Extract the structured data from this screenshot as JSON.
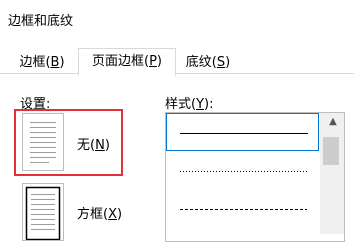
{
  "window": {
    "title": "边框和底纹"
  },
  "tabs": [
    {
      "pre": "边框(",
      "key": "B",
      "post": ")"
    },
    {
      "pre": "页面边框(",
      "key": "P",
      "post": ")"
    },
    {
      "pre": "底纹(",
      "key": "S",
      "post": ")"
    }
  ],
  "active_tab_index": 1,
  "settings": {
    "label": "设置:",
    "options": [
      {
        "pre": "无(",
        "key": "N",
        "post": ")"
      },
      {
        "pre": "方框(",
        "key": "X",
        "post": ")"
      }
    ],
    "selected_index": 0
  },
  "style": {
    "label_pre": "样式(",
    "label_key": "Y",
    "label_post": "):",
    "items": [
      "solid",
      "dotted",
      "dashed"
    ],
    "selected_index": 0
  },
  "colors": {
    "highlight_border": "#e0303a",
    "selection_border": "#0078d7"
  }
}
